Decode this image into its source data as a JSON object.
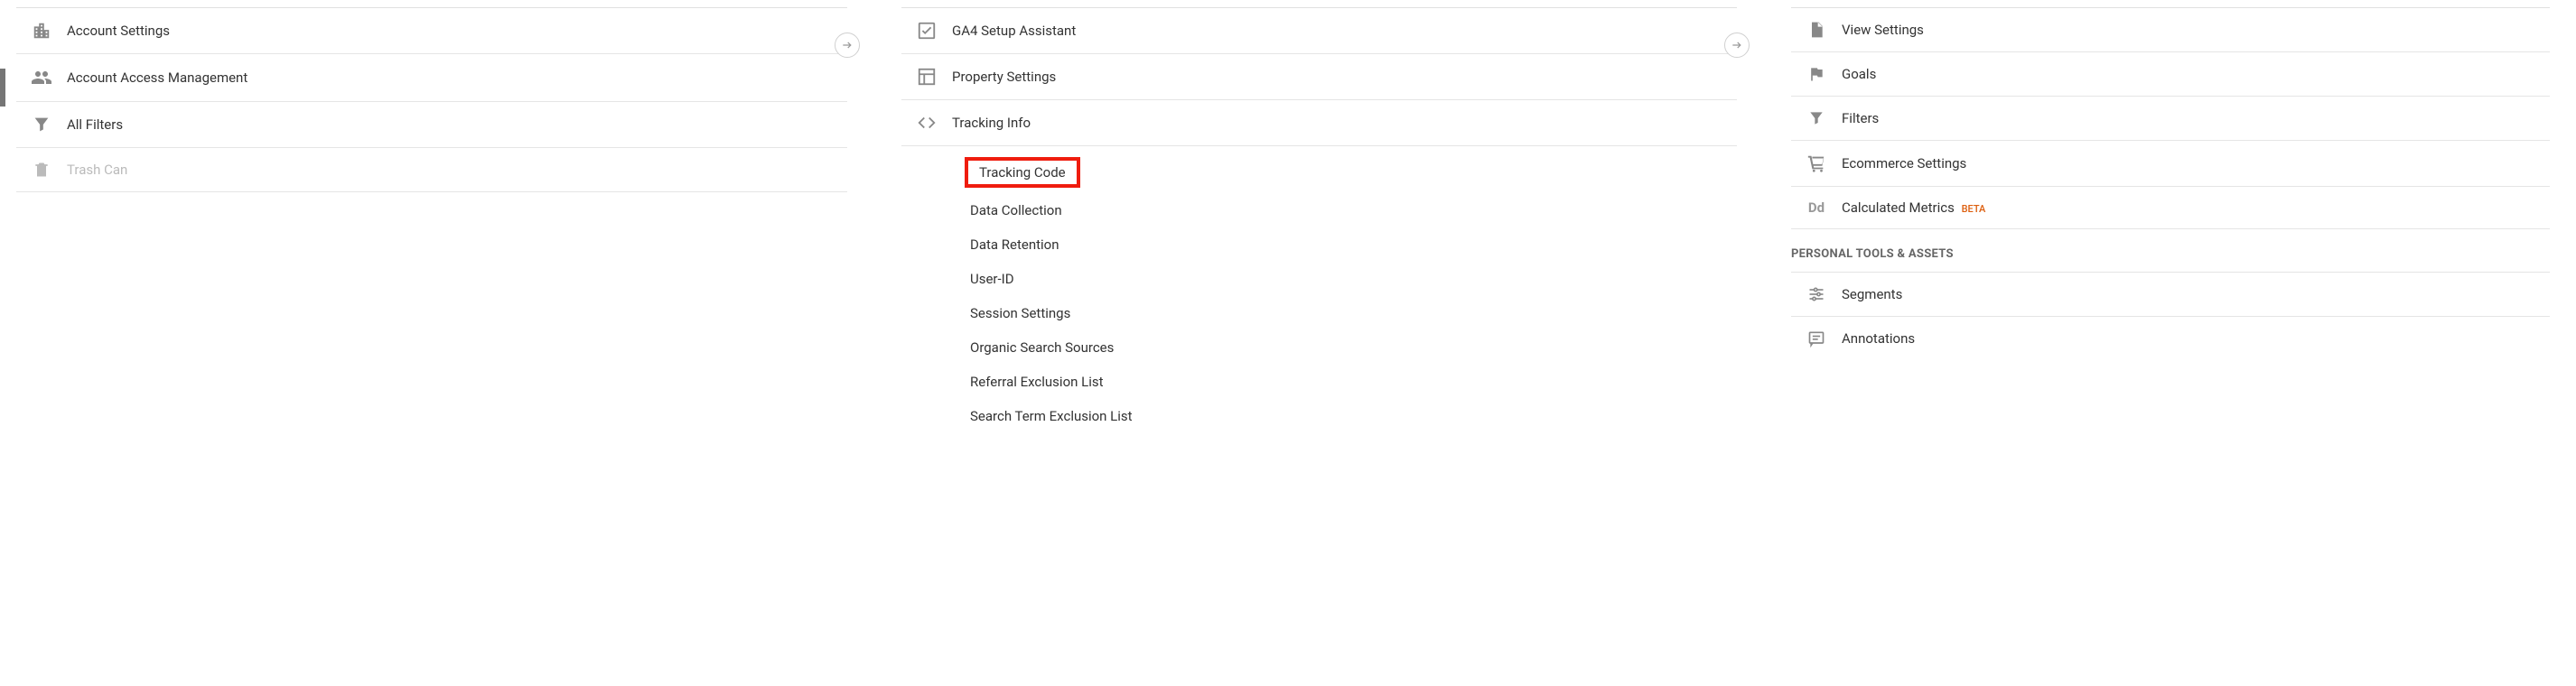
{
  "account": {
    "items": [
      {
        "label": "Account Settings"
      },
      {
        "label": "Account Access Management"
      },
      {
        "label": "All Filters"
      },
      {
        "label": "Trash Can"
      }
    ]
  },
  "property": {
    "items": [
      {
        "label": "GA4 Setup Assistant"
      },
      {
        "label": "Property Settings"
      },
      {
        "label": "Tracking Info"
      }
    ],
    "tracking_sub": [
      "Tracking Code",
      "Data Collection",
      "Data Retention",
      "User-ID",
      "Session Settings",
      "Organic Search Sources",
      "Referral Exclusion List",
      "Search Term Exclusion List"
    ]
  },
  "view": {
    "items": [
      {
        "label": "View Settings"
      },
      {
        "label": "Goals"
      },
      {
        "label": "Filters"
      },
      {
        "label": "Ecommerce Settings"
      },
      {
        "label": "Calculated Metrics",
        "beta": "BETA"
      }
    ],
    "section_header": "PERSONAL TOOLS & ASSETS",
    "personal": [
      {
        "label": "Segments"
      },
      {
        "label": "Annotations"
      }
    ]
  }
}
